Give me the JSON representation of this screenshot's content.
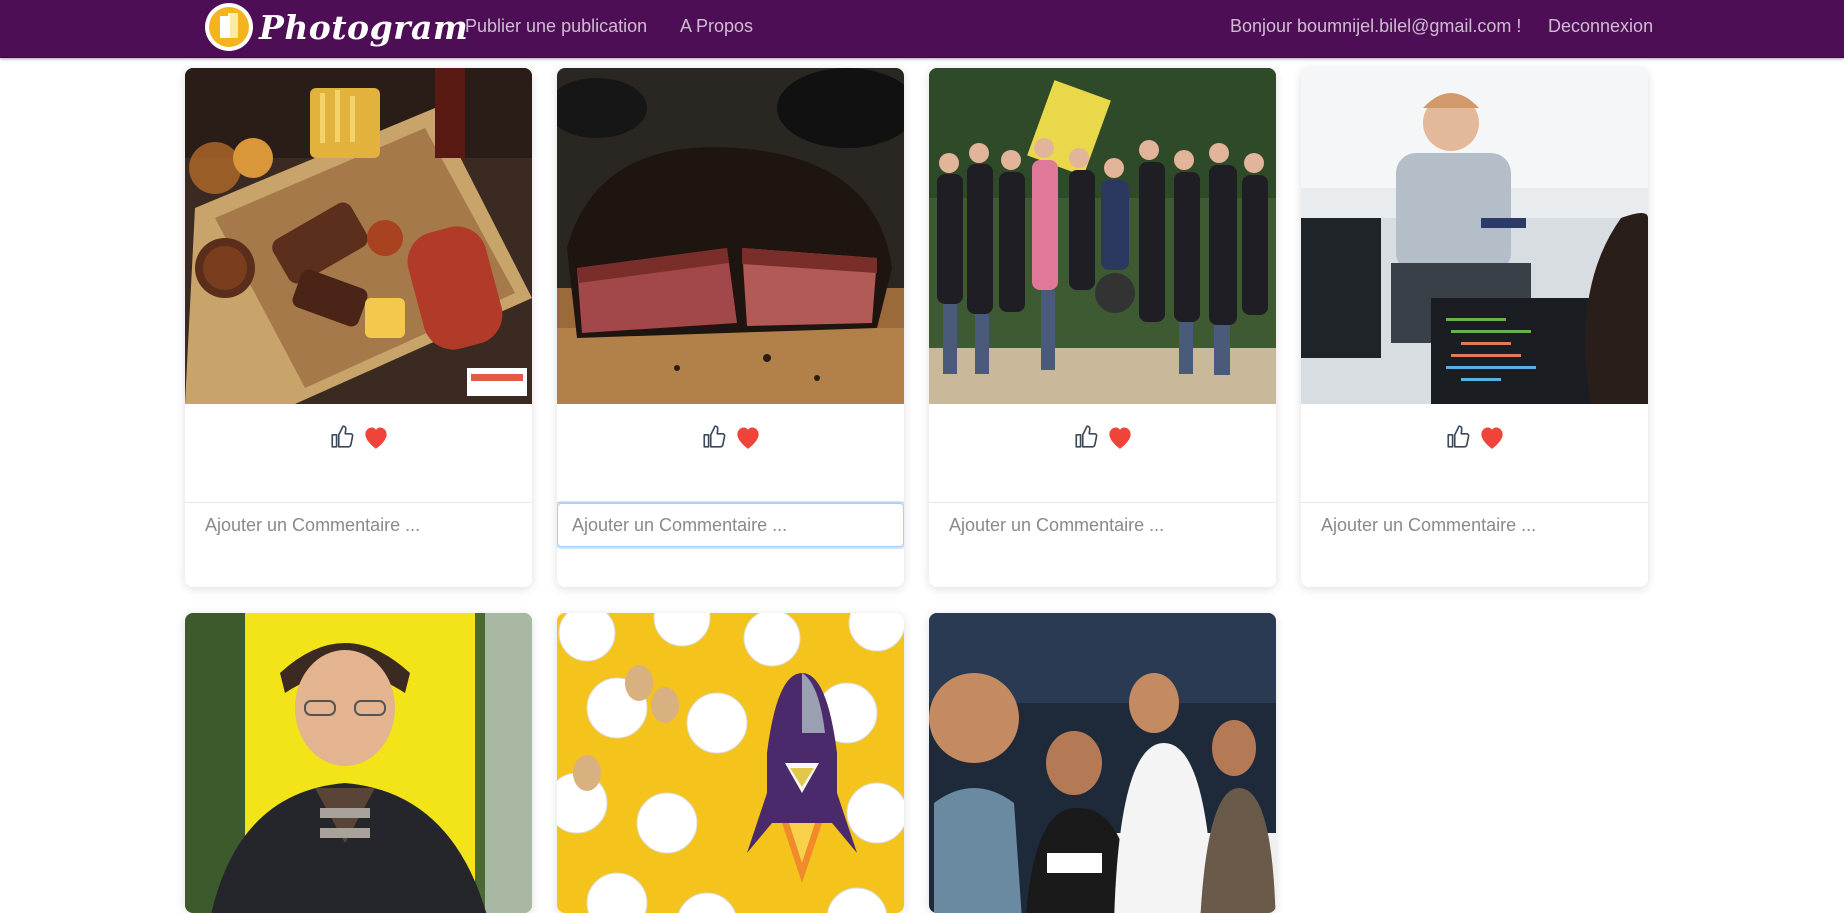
{
  "navbar": {
    "brand": "Photogram",
    "links": {
      "publish": "Publier une publication",
      "about": "A Propos",
      "greeting": "Bonjour boumnijel.bilel@gmail.com !",
      "logout": "Deconnexion"
    },
    "background_color": "#4e0e56"
  },
  "posts": [
    {
      "image_alt": "Plateau barbecue",
      "comment_placeholder": "Ajouter un Commentaire ...",
      "focused": false
    },
    {
      "image_alt": "Brisket fumé",
      "comment_placeholder": "Ajouter un Commentaire ...",
      "focused": true
    },
    {
      "image_alt": "Photo de groupe",
      "comment_placeholder": "Ajouter un Commentaire ...",
      "focused": false
    },
    {
      "image_alt": "Développeur au travail",
      "comment_placeholder": "Ajouter un Commentaire ...",
      "focused": false
    },
    {
      "image_alt": "Portrait homme",
      "comment_placeholder": "",
      "focused": false
    },
    {
      "image_alt": "Moutons et fusée",
      "comment_placeholder": "",
      "focused": false
    },
    {
      "image_alt": "Selfie entre amis",
      "comment_placeholder": "",
      "focused": false
    }
  ],
  "icons": {
    "like": "thumbs-up-icon",
    "favorite": "heart-icon"
  },
  "colors": {
    "heart": "#f0443a",
    "thumb": "#3a4a5a",
    "focus_ring": "#a8cff5"
  }
}
